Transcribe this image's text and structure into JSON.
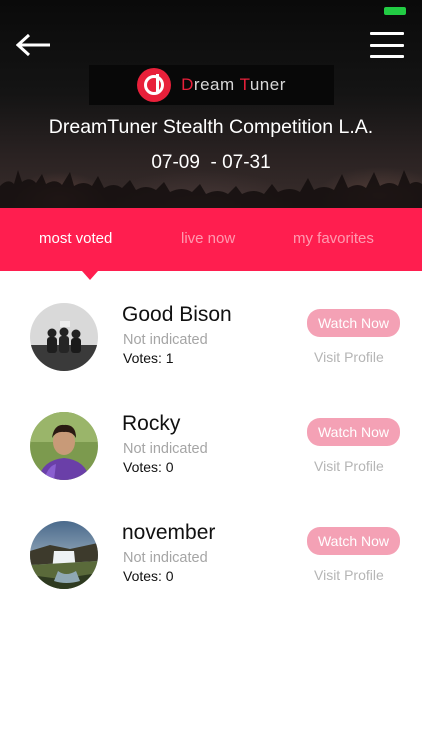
{
  "header": {
    "event_title": "DreamTuner Stealth Competition L.A.",
    "event_dates": "07-09  - 07-31",
    "logo": {
      "text_first": "D",
      "text_rest": "ream ",
      "text_accent": "T",
      "text_end": "uner"
    },
    "colors": {
      "accent": "#e8203a",
      "battery": "#22cc44"
    }
  },
  "icons": {
    "back": "back-arrow-icon",
    "menu": "hamburger-menu-icon"
  },
  "tabs": [
    {
      "label": "most voted",
      "active": true
    },
    {
      "label": "live now",
      "active": false
    },
    {
      "label": "my favorites",
      "active": false
    }
  ],
  "colors": {
    "tab_bar": "#ff1e4f",
    "watch_button": "#f4a1b5",
    "muted_text": "#a5a5a5"
  },
  "contestants": [
    {
      "name": "Good Bison",
      "location": "Not indicated",
      "votes": "Votes: 1",
      "watch_label": "Watch Now",
      "profile_label": "Visit Profile"
    },
    {
      "name": "Rocky",
      "location": "Not indicated",
      "votes": "Votes: 0",
      "watch_label": "Watch Now",
      "profile_label": "Visit Profile"
    },
    {
      "name": "november",
      "location": "Not indicated",
      "votes": "Votes: 0",
      "watch_label": "Watch Now",
      "profile_label": "Visit Profile"
    }
  ]
}
